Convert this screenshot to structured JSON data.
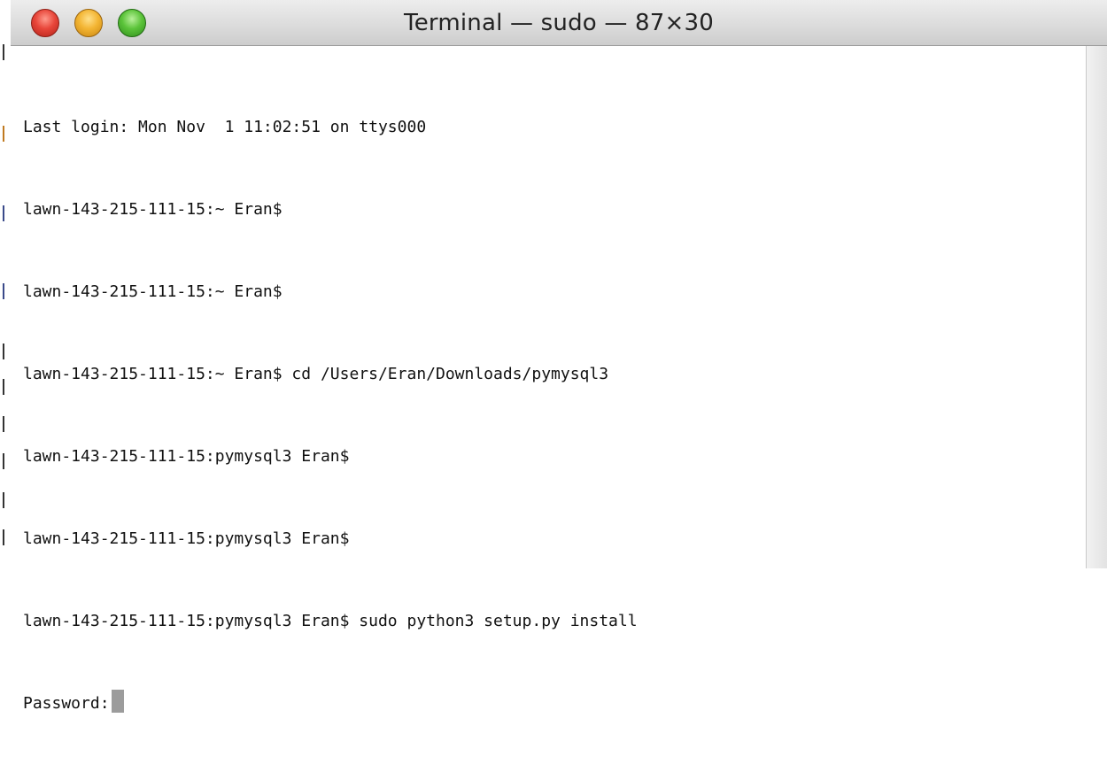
{
  "window": {
    "title": "Terminal — sudo — 87×30",
    "controls": {
      "close_icon": "close-icon",
      "minimize_icon": "minimize-icon",
      "zoom_icon": "zoom-icon"
    }
  },
  "terminal": {
    "lines": [
      "Last login: Mon Nov  1 11:02:51 on ttys000",
      "lawn-143-215-111-15:~ Eran$",
      "lawn-143-215-111-15:~ Eran$",
      "lawn-143-215-111-15:~ Eran$ cd /Users/Eran/Downloads/pymysql3",
      "lawn-143-215-111-15:pymysql3 Eran$",
      "lawn-143-215-111-15:pymysql3 Eran$",
      "lawn-143-215-111-15:pymysql3 Eran$ sudo python3 setup.py install"
    ],
    "prompt_text": "Password:"
  },
  "colors": {
    "close": "#e8463a",
    "minimize": "#f3b533",
    "zoom": "#5cc43a",
    "cursor": "#9c9c9c"
  }
}
